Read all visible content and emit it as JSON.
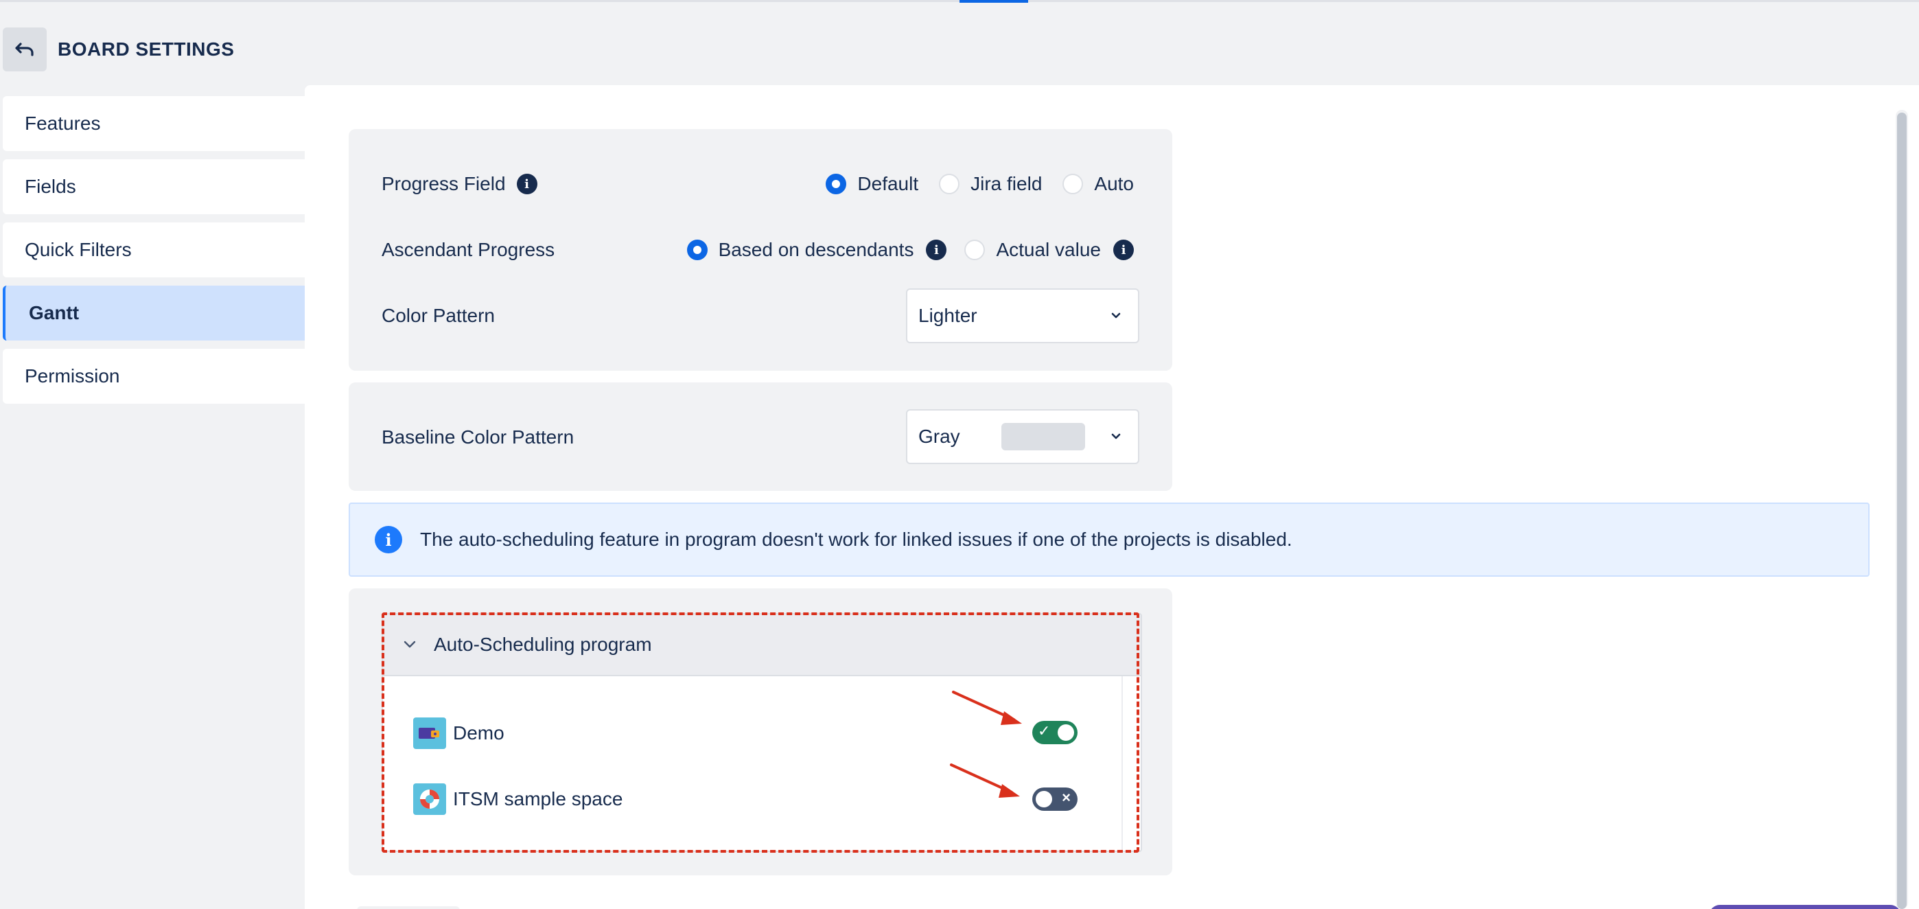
{
  "header": {
    "title": "BOARD SETTINGS"
  },
  "sidebar": {
    "items": [
      {
        "label": "Features"
      },
      {
        "label": "Fields"
      },
      {
        "label": "Quick Filters"
      },
      {
        "label": "Gantt"
      },
      {
        "label": "Permission"
      }
    ],
    "active": "Gantt"
  },
  "progress_field": {
    "label": "Progress Field",
    "options": [
      "Default",
      "Jira field",
      "Auto"
    ],
    "selected": "Default"
  },
  "ascendant_progress": {
    "label": "Ascendant Progress",
    "options": [
      "Based on descendants",
      "Actual value"
    ],
    "selected": "Based on descendants"
  },
  "color_pattern": {
    "label": "Color Pattern",
    "value": "Lighter"
  },
  "baseline_color_pattern": {
    "label": "Baseline Color Pattern",
    "value": "Gray",
    "swatch_color": "#dcdfe4"
  },
  "banner": {
    "message": "The auto-scheduling feature in program doesn't work for linked issues if one of the projects is disabled."
  },
  "auto_scheduling": {
    "title": "Auto-Scheduling program",
    "projects": [
      {
        "name": "Demo",
        "enabled": true
      },
      {
        "name": "ITSM sample space",
        "enabled": false
      }
    ]
  },
  "colors": {
    "accent": "#0c66e4",
    "toggle_on": "#1f845a",
    "toggle_off": "#44546f",
    "annotation": "#d9301c"
  }
}
